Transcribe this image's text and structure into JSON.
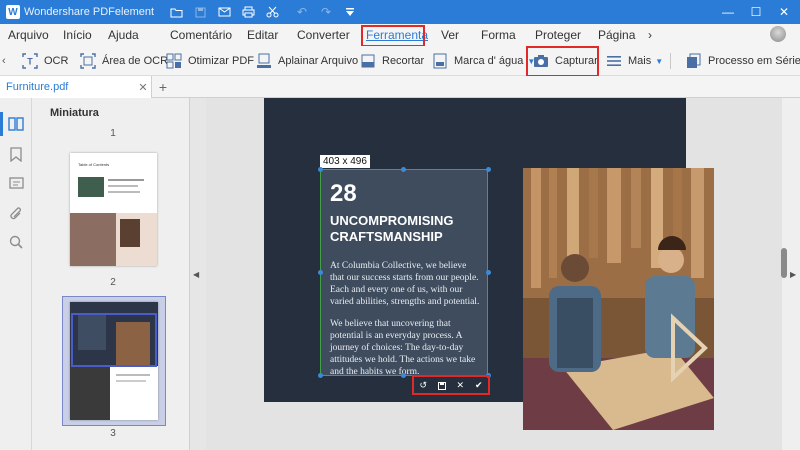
{
  "titlebar": {
    "logo_letter": "W",
    "app_title": "Wondershare PDFelement",
    "quick_icons": [
      "folder-icon",
      "save-icon",
      "mail-icon",
      "print-icon",
      "scissors-icon",
      "undo-icon",
      "redo-icon",
      "customize-icon"
    ],
    "window_controls": {
      "minimize": "—",
      "maximize": "☐",
      "close": "✕"
    }
  },
  "menu": {
    "items": [
      "Arquivo",
      "Início",
      "Ajuda",
      "Comentário",
      "Editar",
      "Converter",
      "Ferramenta",
      "Ver",
      "Forma",
      "Proteger",
      "Página"
    ],
    "active": "Ferramenta",
    "more_arrow": "›"
  },
  "toolbar": {
    "scroll_left": "‹",
    "ocr": "OCR",
    "ocr_area": "Área de OCR",
    "optimize": "Otimizar PDF",
    "flatten": "Aplainar Arquivo",
    "crop": "Recortar",
    "watermark": "Marca d' água",
    "capture": "Capturar",
    "more": "Mais",
    "batch": "Processo em Série"
  },
  "tabs": {
    "document": "Furniture.pdf",
    "close": "✕",
    "add": "+"
  },
  "thumbnail_panel": {
    "title": "Miniatura",
    "page_numbers": [
      "1",
      "2",
      "3"
    ],
    "page2_heading": "Table of Contents"
  },
  "document": {
    "selection_size": "403 x 496",
    "page_number": "28",
    "heading_line1": "UNCOMPROMISING",
    "heading_line2": "CRAFTSMANSHIP",
    "paragraph1": "At Columbia Collective, we believe that our success starts from our people. Each and every one of us, with our varied abilities, strengths and potential.",
    "paragraph2": "We believe that uncovering that potential is an everyday process. A journey of choices: The day-to-day attitudes we hold. The actions we take and the habits we form."
  },
  "capture_actions": [
    "undo-icon",
    "save-icon",
    "close-icon",
    "check-icon"
  ],
  "colors": {
    "accent": "#2b7cd6",
    "highlight": "#e02a2a",
    "selection_border": "#43a047",
    "page_bg": "#262f3d"
  }
}
